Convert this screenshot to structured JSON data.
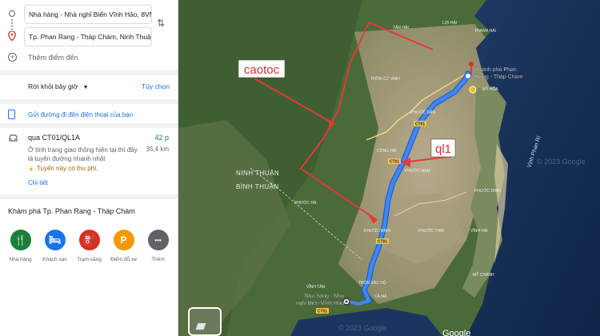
{
  "directions": {
    "origin": "Nhà hàng - Nhà nghỉ Biển Vĩnh Hảo, 8VM",
    "destination": "Tp. Phan Rang - Tháp Chàm, Ninh Thuận",
    "add_destination": "Thêm điểm đến",
    "leave_label": "Rời khỏi bây giờ",
    "options_label": "Tùy chọn",
    "send_to_phone": "Gửi đường đi đến điện thoại của bạn"
  },
  "route": {
    "name": "qua CT01/QL1A",
    "time": "42 p",
    "description": "Ở tình trạng giao thông hiện tại thì đây là tuyến đường nhanh nhất",
    "distance": "35,4 km",
    "toll_notice": "Tuyến này có thu phí.",
    "details_label": "Chi tiết"
  },
  "explore": {
    "title": "Khám phá Tp. Phan Rang - Tháp Chàm",
    "categories": [
      {
        "label": "Nhà hàng",
        "icon": "restaurant-icon",
        "color": "#188038",
        "glyph": "🍴"
      },
      {
        "label": "Khách sạn",
        "icon": "hotel-icon",
        "color": "#1a73e8",
        "glyph": "🛏"
      },
      {
        "label": "Trạm xăng",
        "icon": "gas-station-icon",
        "color": "#d93025",
        "glyph": "⛽"
      },
      {
        "label": "Điểm đỗ xe",
        "icon": "parking-icon",
        "color": "#f29900",
        "glyph": "P"
      },
      {
        "label": "Thêm",
        "icon": "more-icon",
        "color": "#5f6368",
        "glyph": "•••"
      }
    ]
  },
  "map": {
    "annotation_caotoc": "caotoc",
    "annotation_ql1": "ql1",
    "destination_label_line1": "Thành phố Phan",
    "destination_label_line2": "Rang - Tháp Chàm",
    "origin_label_line1": "Nhà hàng - Nhà",
    "origin_label_line2": "nghỉ Biển Vĩnh Hảo",
    "province_north": "NINH THUẬN",
    "province_south": "BÌNH THUẬN",
    "bay_label": "Vịnh Phan Rí",
    "copyright": "© 2023 Google",
    "google": "Google",
    "road_badge": "CT01",
    "place_labels": [
      "TÂN HẢI",
      "THANH HẢI",
      "PHƯỚC DÂN",
      "PHƯỚC NAM",
      "PHƯỚC MINH",
      "PHƯỚC DINH",
      "MỸ HÒA",
      "CÀ NÁ",
      "VĨNH TÂN",
      "THÔN SÁC HỘ",
      "PHƯỚC HÀ",
      "MỸ CHÁNH",
      "LỢI HẢI",
      "VĨNH HẢI",
      "CÔNG HẢI",
      "PHƯỚC THÁI",
      "THÔN CỬ VINH"
    ],
    "accent_route": "#4285f4",
    "accent_annotation": "#e53935"
  }
}
